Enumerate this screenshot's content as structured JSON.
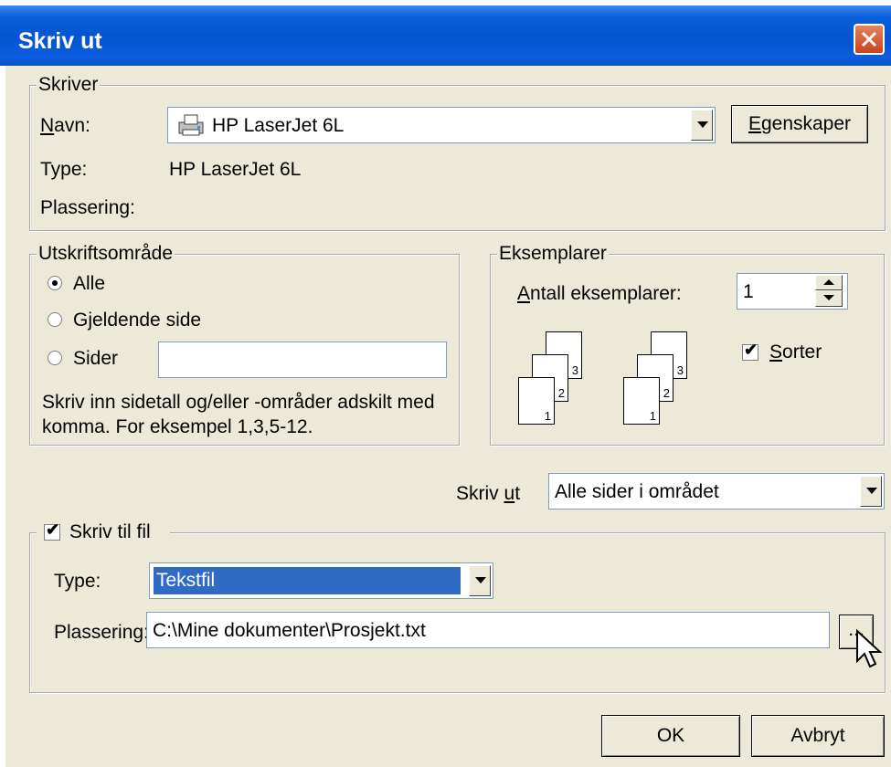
{
  "window": {
    "title": "Skriv ut"
  },
  "printer": {
    "group_label": "Skriver",
    "name_label": "Navn:",
    "name_value": "HP LaserJet 6L",
    "properties_button": "Egenskaper",
    "type_label": "Type:",
    "type_value": "HP LaserJet 6L",
    "location_label": "Plassering:"
  },
  "range": {
    "group_label": "Utskriftsområde",
    "all_label": "Alle",
    "current_label": "Gjeldende side",
    "pages_label": "Sider",
    "pages_value": "",
    "hint_line1": "Skriv inn sidetall og/eller -områder adskilt med",
    "hint_line2": "komma.  For eksempel 1,3,5-12."
  },
  "copies": {
    "group_label": "Eksemplarer",
    "count_label": "Antall eksemplarer:",
    "count_value": "1",
    "collate_label": "Sorter",
    "collate_checked": true
  },
  "print_what": {
    "label": "Skriv ut",
    "value": "Alle sider i området"
  },
  "to_file": {
    "checkbox_label": "Skriv til fil",
    "checked": true,
    "type_label": "Type:",
    "type_value": "Tekstfil",
    "location_label": "Plassering:",
    "location_value": "C:\\Mine dokumenter\\Prosjekt.txt",
    "browse_label": "..."
  },
  "buttons": {
    "ok": "OK",
    "cancel": "Avbryt"
  },
  "colors": {
    "titlebar": "#0554d0",
    "dialog_bg": "#ece9d8",
    "selection": "#316ac5",
    "close_button": "#c9441f"
  }
}
